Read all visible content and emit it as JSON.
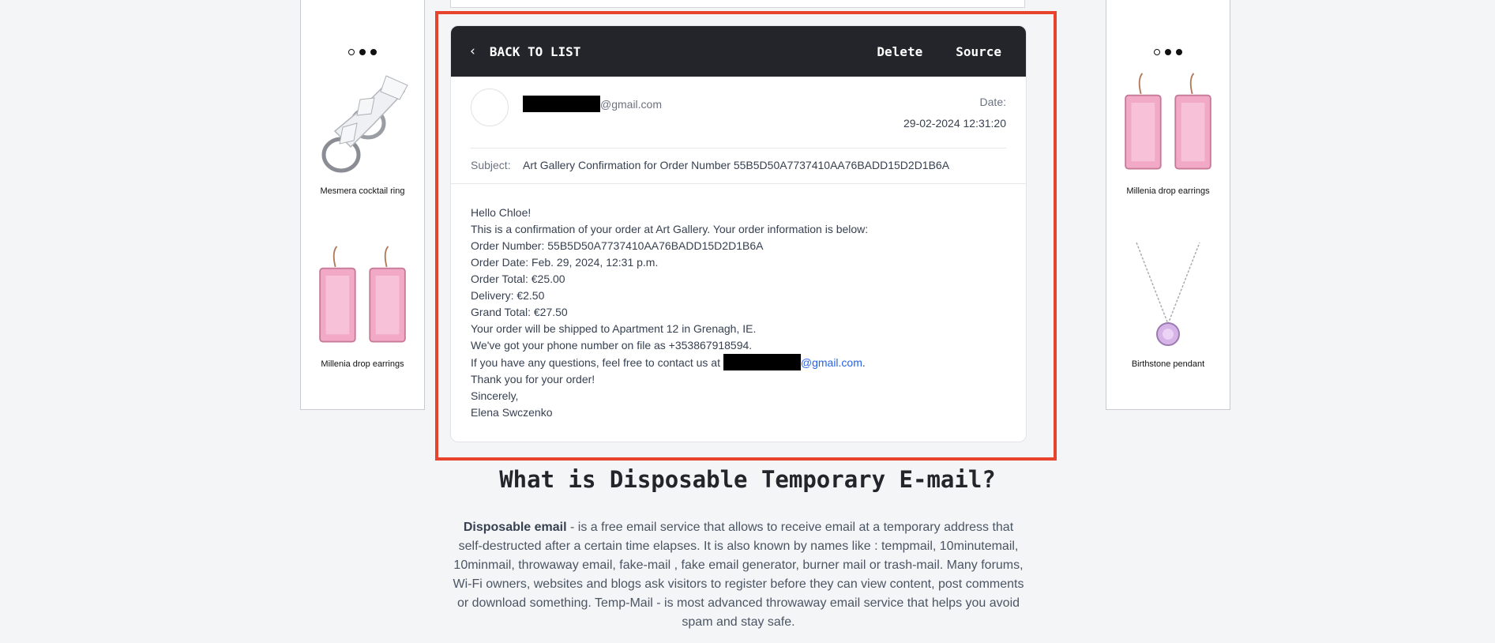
{
  "left_ad": {
    "products": [
      {
        "name": "Mesmera cocktail ring"
      },
      {
        "name": "Millenia drop earrings"
      }
    ]
  },
  "right_ad": {
    "products": [
      {
        "name": "Millenia drop earrings"
      },
      {
        "name": "Birthstone pendant"
      }
    ]
  },
  "mail": {
    "header": {
      "back_label": "BACK TO LIST",
      "delete_label": "Delete",
      "source_label": "Source"
    },
    "sender_domain": "@gmail.com",
    "date_label": "Date:",
    "date_value": "29-02-2024 12:31:20",
    "subject_label": "Subject:",
    "subject": "Art Gallery Confirmation for Order Number 55B5D50A7737410AA76BADD15D2D1B6A",
    "body": {
      "greeting": "Hello Chloe!",
      "intro": "This is a confirmation of your order at Art Gallery. Your order information is below:",
      "order_number": "Order Number: 55B5D50A7737410AA76BADD15D2D1B6A",
      "order_date": "Order Date: Feb. 29, 2024, 12:31 p.m.",
      "order_total": "Order Total: €25.00",
      "delivery": "Delivery: €2.50",
      "grand_total": "Grand Total: €27.50",
      "shipping": "Your order will be shipped to Apartment 12 in Grenagh, IE.",
      "phone": "We've got your phone number on file as +353867918594.",
      "contact_prefix": "If you have any questions, feel free to contact us at",
      "contact_domain": "@gmail.com",
      "contact_suffix": ".",
      "thanks": "Thank you for your order!",
      "signoff": "Sincerely,",
      "signature": "Elena Swczenko"
    }
  },
  "info": {
    "title": "What is Disposable Temporary E-mail?",
    "lead_bold": "Disposable email",
    "paragraph": " - is a free email service that allows to receive email at a temporary address that self-destructed after a certain time elapses. It is also known by names like : tempmail, 10minutemail, 10minmail, throwaway email, fake-mail , fake email generator, burner mail or trash-mail. Many forums, Wi-Fi owners, websites and blogs ask visitors to register before they can view content, post comments or download something. Temp-Mail - is most advanced throwaway email service that helps you avoid spam and stay safe."
  },
  "colors": {
    "highlight": "#e8432c",
    "header_bg": "#23252b",
    "link": "#2563eb"
  }
}
